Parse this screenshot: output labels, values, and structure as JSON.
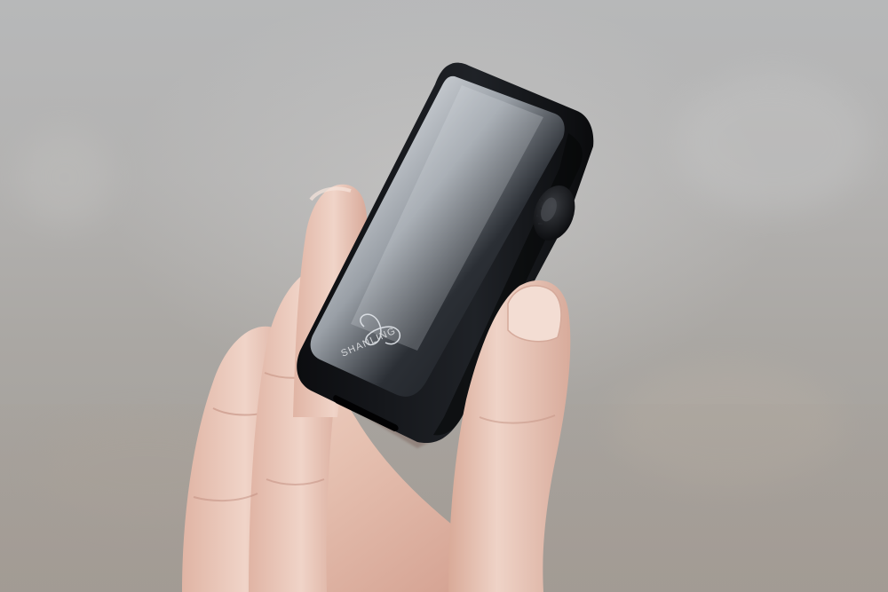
{
  "scene": {
    "description_label": "",
    "device": {
      "brand_text": "SHANLING",
      "logo_glyph": "ⓢ",
      "body_color": "#111317",
      "glass_color": "#1a1d22",
      "highlight_color": "#d7dbe0"
    },
    "hand": {
      "skin_color": "#e6c2b4",
      "shadow_color": "#c9988a"
    }
  }
}
